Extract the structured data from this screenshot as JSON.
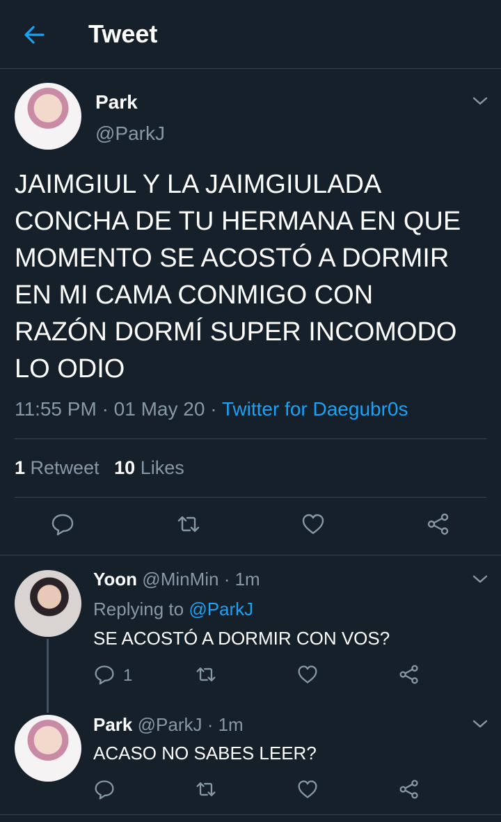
{
  "header": {
    "title": "Tweet",
    "back_icon": "arrow-left-icon"
  },
  "main_tweet": {
    "display_name": "Park",
    "handle": "@ParkJ",
    "text_lines": [
      "JAIMGIUL Y LA JAIMGIULADA",
      "CONCHA DE TU HERMANA EN QUE",
      "MOMENTO SE ACOSTÓ A DORMIR",
      "EN MI CAMA CONMIGO CON",
      "RAZÓN DORMÍ SUPER INCOMODO",
      "LO ODIO"
    ],
    "time": "11:55 PM",
    "sep": "·",
    "date": "01 May 20",
    "source": "Twitter for Daegubr0s",
    "retweets_count": "1",
    "retweets_label": "Retweet",
    "likes_count": "10",
    "likes_label": "Likes"
  },
  "replies": [
    {
      "display_name": "Yoon",
      "handle": "@MinMin",
      "time": "· 1m",
      "replying_label": "Replying to",
      "replying_handle": "@ParkJ",
      "text": "SE ACOSTÓ A DORMIR CON VOS?",
      "reply_count": "1"
    },
    {
      "display_name": "Park",
      "handle": "@ParkJ",
      "time": "· 1m",
      "text": "ACASO NO SABES LEER?"
    }
  ],
  "colors": {
    "background": "#15202b",
    "accent": "#1da1f2",
    "muted": "#8899a6",
    "divider": "#38444d"
  }
}
